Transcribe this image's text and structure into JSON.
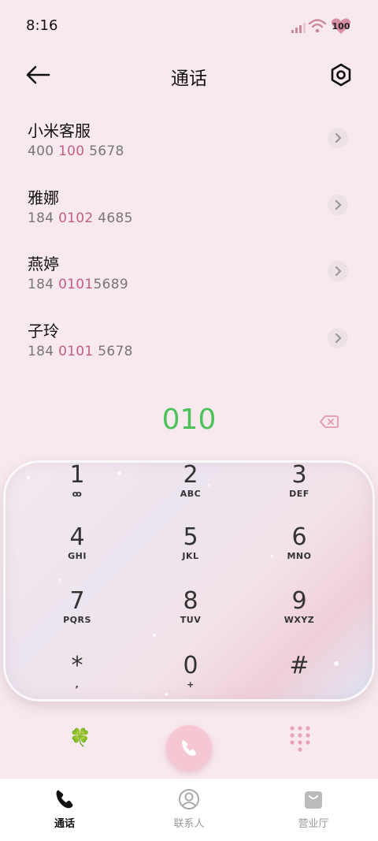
{
  "status": {
    "time": "8:16",
    "battery": "100"
  },
  "header": {
    "title": "通话"
  },
  "contacts": [
    {
      "name": "小米客服",
      "num_pre": "400 ",
      "num_hl": "100",
      "num_post": " 5678"
    },
    {
      "name": "雅娜",
      "num_pre": "184 ",
      "num_hl": "0102",
      "num_post": " 4685"
    },
    {
      "name": "燕婷",
      "num_pre": "184 ",
      "num_hl": "0101",
      "num_post": "5689"
    },
    {
      "name": "子玲",
      "num_pre": "184 ",
      "num_hl": "0101",
      "num_post": " 5678"
    }
  ],
  "dial": {
    "entry": "010"
  },
  "keys": [
    {
      "digit": "1",
      "letters": "ꝏ"
    },
    {
      "digit": "2",
      "letters": "ABC"
    },
    {
      "digit": "3",
      "letters": "DEF"
    },
    {
      "digit": "4",
      "letters": "GHI"
    },
    {
      "digit": "5",
      "letters": "JKL"
    },
    {
      "digit": "6",
      "letters": "MNO"
    },
    {
      "digit": "7",
      "letters": "PQRS"
    },
    {
      "digit": "8",
      "letters": "TUV"
    },
    {
      "digit": "9",
      "letters": "WXYZ"
    },
    {
      "digit": "*",
      "letters": ","
    },
    {
      "digit": "0",
      "letters": "+"
    },
    {
      "digit": "#",
      "letters": ""
    }
  ],
  "nav": {
    "calls": "通话",
    "contacts": "联系人",
    "hall": "营业厅"
  },
  "colors": {
    "accent_green": "#4cc25a",
    "highlight": "#c4607a",
    "call_button": "#f4c7d3"
  }
}
